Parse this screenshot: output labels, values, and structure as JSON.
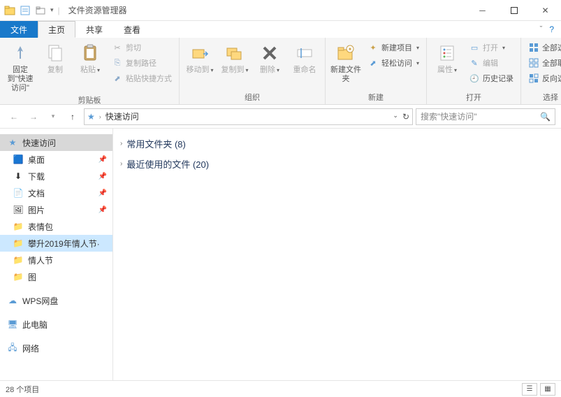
{
  "window": {
    "title": "文件资源管理器"
  },
  "tabs": {
    "file": "文件",
    "home": "主页",
    "share": "共享",
    "view": "查看"
  },
  "ribbon": {
    "clipboard": {
      "label": "剪贴板",
      "pin": "固定到\"快速访问\"",
      "copy": "复制",
      "paste": "粘贴",
      "cut": "剪切",
      "copypath": "复制路径",
      "pasteshortcut": "粘贴快捷方式"
    },
    "organize": {
      "label": "组织",
      "moveto": "移动到",
      "copyto": "复制到",
      "delete": "删除",
      "rename": "重命名"
    },
    "new": {
      "label": "新建",
      "newfolder": "新建文件夹",
      "newitem": "新建项目",
      "easyaccess": "轻松访问"
    },
    "open": {
      "label": "打开",
      "properties": "属性",
      "open": "打开",
      "edit": "编辑",
      "history": "历史记录"
    },
    "select": {
      "label": "选择",
      "selectall": "全部选择",
      "selectnone": "全部取消",
      "invert": "反向选择"
    }
  },
  "address": {
    "location": "快速访问"
  },
  "search": {
    "placeholder": "搜索\"快速访问\""
  },
  "sidebar": {
    "quickaccess": "快速访问",
    "items": [
      {
        "label": "桌面",
        "pinned": true
      },
      {
        "label": "下载",
        "pinned": true
      },
      {
        "label": "文档",
        "pinned": true
      },
      {
        "label": "图片",
        "pinned": true
      },
      {
        "label": "表情包",
        "pinned": false
      },
      {
        "label": "攀升2019年情人节·",
        "pinned": false,
        "selected": true
      },
      {
        "label": "情人节",
        "pinned": false
      },
      {
        "label": "图",
        "pinned": false
      }
    ],
    "wps": "WPS网盘",
    "thispc": "此电脑",
    "network": "网络"
  },
  "content": {
    "frequent": "常用文件夹 (8)",
    "recent": "最近使用的文件 (20)"
  },
  "status": {
    "items": "28 个项目"
  }
}
